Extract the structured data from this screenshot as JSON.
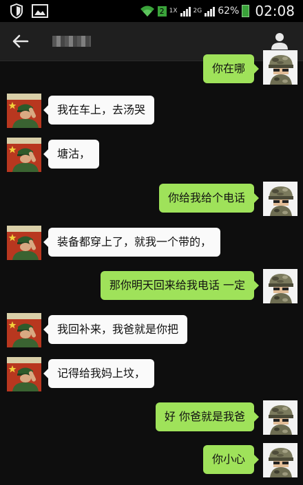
{
  "status_bar": {
    "sim_slot": "2",
    "network_1": "1X",
    "network_2": "2G",
    "battery_percent": "62%",
    "time": "02:08"
  },
  "header": {
    "back_icon": "arrow-left-icon",
    "profile_icon": "person-icon"
  },
  "messages": [
    {
      "side": "out",
      "text": "你在哪"
    },
    {
      "side": "in",
      "text": "我在车上，去汤哭"
    },
    {
      "side": "in",
      "text": "塘沽，"
    },
    {
      "side": "out",
      "text": "你给我给个电话"
    },
    {
      "side": "in",
      "text": "装备都穿上了，就我一个带的，"
    },
    {
      "side": "out",
      "text": "那你明天回来给我电话 一定"
    },
    {
      "side": "in",
      "text": "我回补来，我爸就是你把"
    },
    {
      "side": "in",
      "text": "记得给我妈上坟，"
    },
    {
      "side": "out",
      "text": "好 你爸就是我爸"
    },
    {
      "side": "out",
      "text": "你小心"
    }
  ],
  "colors": {
    "outgoing_bubble": "#9fe25a",
    "incoming_bubble": "#fafafa",
    "background": "#0e0e0e",
    "header": "#1f1f1f"
  }
}
